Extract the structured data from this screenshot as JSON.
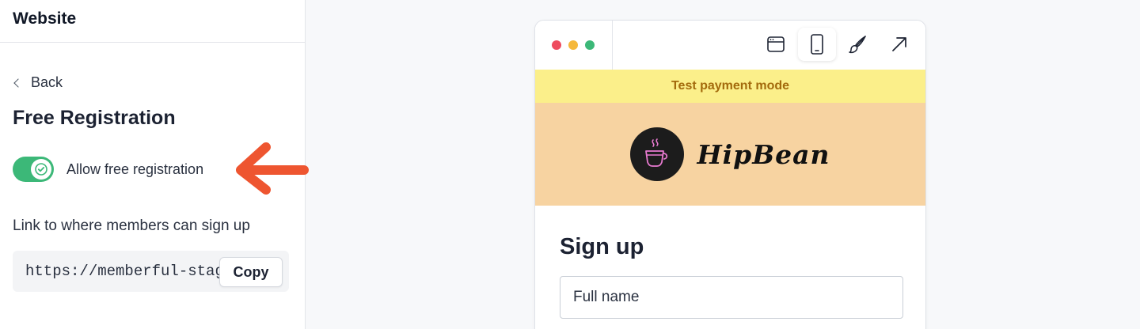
{
  "panel": {
    "title": "Website",
    "back_label": "Back",
    "section_title": "Free Registration",
    "toggle": {
      "label": "Allow free registration",
      "checked": true,
      "color": "#3cb878"
    },
    "link_label": "Link to where members can sign up",
    "url": "https://memberful-staging",
    "copy_label": "Copy",
    "annotation_arrow_color": "#ee5530"
  },
  "preview": {
    "window_dots": [
      "#ee4b5e",
      "#f5b83a",
      "#3cb878"
    ],
    "toolbar": [
      {
        "icon": "browser-window-icon",
        "active": false
      },
      {
        "icon": "mobile-phone-icon",
        "active": true
      },
      {
        "icon": "paintbrush-icon",
        "active": false
      },
      {
        "icon": "external-link-arrow-icon",
        "active": false
      }
    ],
    "test_banner": "Test payment mode",
    "brand": {
      "name": "HipBean",
      "logo_icon": "coffee-cup-icon"
    },
    "form": {
      "title": "Sign up",
      "fullname_placeholder": "Full name"
    }
  }
}
